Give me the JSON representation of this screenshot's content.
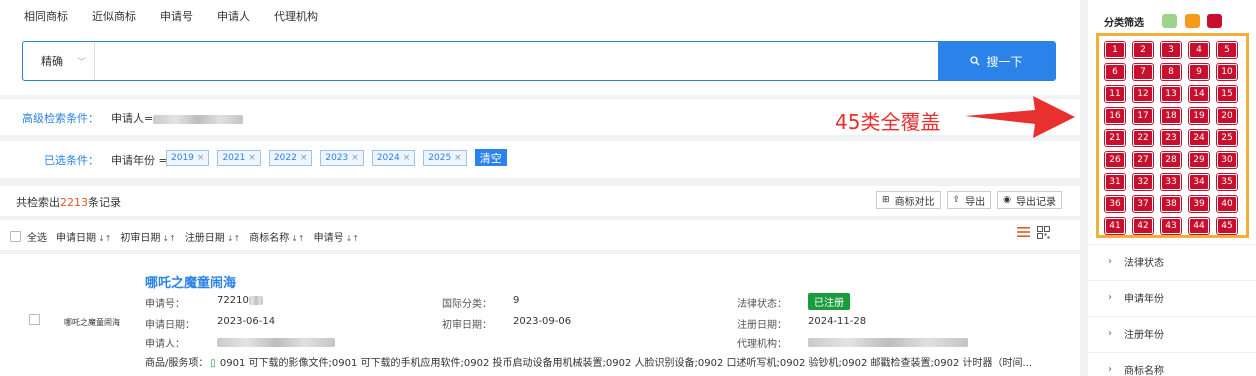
{
  "tabs": [
    "相同商标",
    "近似商标",
    "申请号",
    "申请人",
    "代理机构"
  ],
  "search": {
    "mode": "精确",
    "value": "",
    "button": "搜一下"
  },
  "advanced": {
    "label": "高级检索条件：",
    "value_prefix": "申请人="
  },
  "selected": {
    "label": "已选条件：",
    "field": "申请年份 =",
    "chips": [
      "2019",
      "2021",
      "2022",
      "2023",
      "2024",
      "2025"
    ],
    "clear": "清空"
  },
  "results": {
    "count_prefix": "共检索出",
    "count": "2213",
    "count_suffix": "条记录",
    "actions": [
      "商标对比",
      "导出",
      "导出记录"
    ]
  },
  "sort": {
    "select_all": "全选",
    "fields": [
      "申请日期",
      "初审日期",
      "注册日期",
      "商标名称",
      "申请号"
    ]
  },
  "item": {
    "title": "哪吒之魔童闹海",
    "logo_text": "哪吒之魔童闹海",
    "app_no_label": "申请号：",
    "app_no": "72210",
    "intl_class_label": "国际分类：",
    "intl_class": "9",
    "legal_status_label": "法律状态：",
    "legal_status": "已注册",
    "app_date_label": "申请日期：",
    "app_date": "2023-06-14",
    "prelim_date_label": "初审日期：",
    "prelim_date": "2023-09-06",
    "reg_date_label": "注册日期：",
    "reg_date": "2024-11-28",
    "applicant_label": "申请人：",
    "agent_label": "代理机构：",
    "goods_label": "商品/服务项：",
    "goods": "0901 可下载的影像文件;0901 可下载的手机应用软件;0902 投币启动设备用机械装置;0902 人脸识别设备;0902 口述听写机;0902 验钞机;0902 邮戳检查装置;0902 计时器（时间..."
  },
  "sidebar": {
    "filter_title": "分类筛选",
    "swatch_colors": [
      "#9fd28a",
      "#f59b1c",
      "#c8102e"
    ],
    "classes": [
      "1",
      "2",
      "3",
      "4",
      "5",
      "6",
      "7",
      "8",
      "9",
      "10",
      "11",
      "12",
      "13",
      "14",
      "15",
      "16",
      "17",
      "18",
      "19",
      "20",
      "21",
      "22",
      "23",
      "24",
      "25",
      "26",
      "27",
      "28",
      "29",
      "30",
      "31",
      "32",
      "33",
      "34",
      "35",
      "36",
      "37",
      "38",
      "39",
      "40",
      "41",
      "42",
      "43",
      "44",
      "45"
    ],
    "rows": [
      "法律状态",
      "申请年份",
      "注册年份",
      "商标名称"
    ]
  },
  "annotation": "45类全覆盖"
}
